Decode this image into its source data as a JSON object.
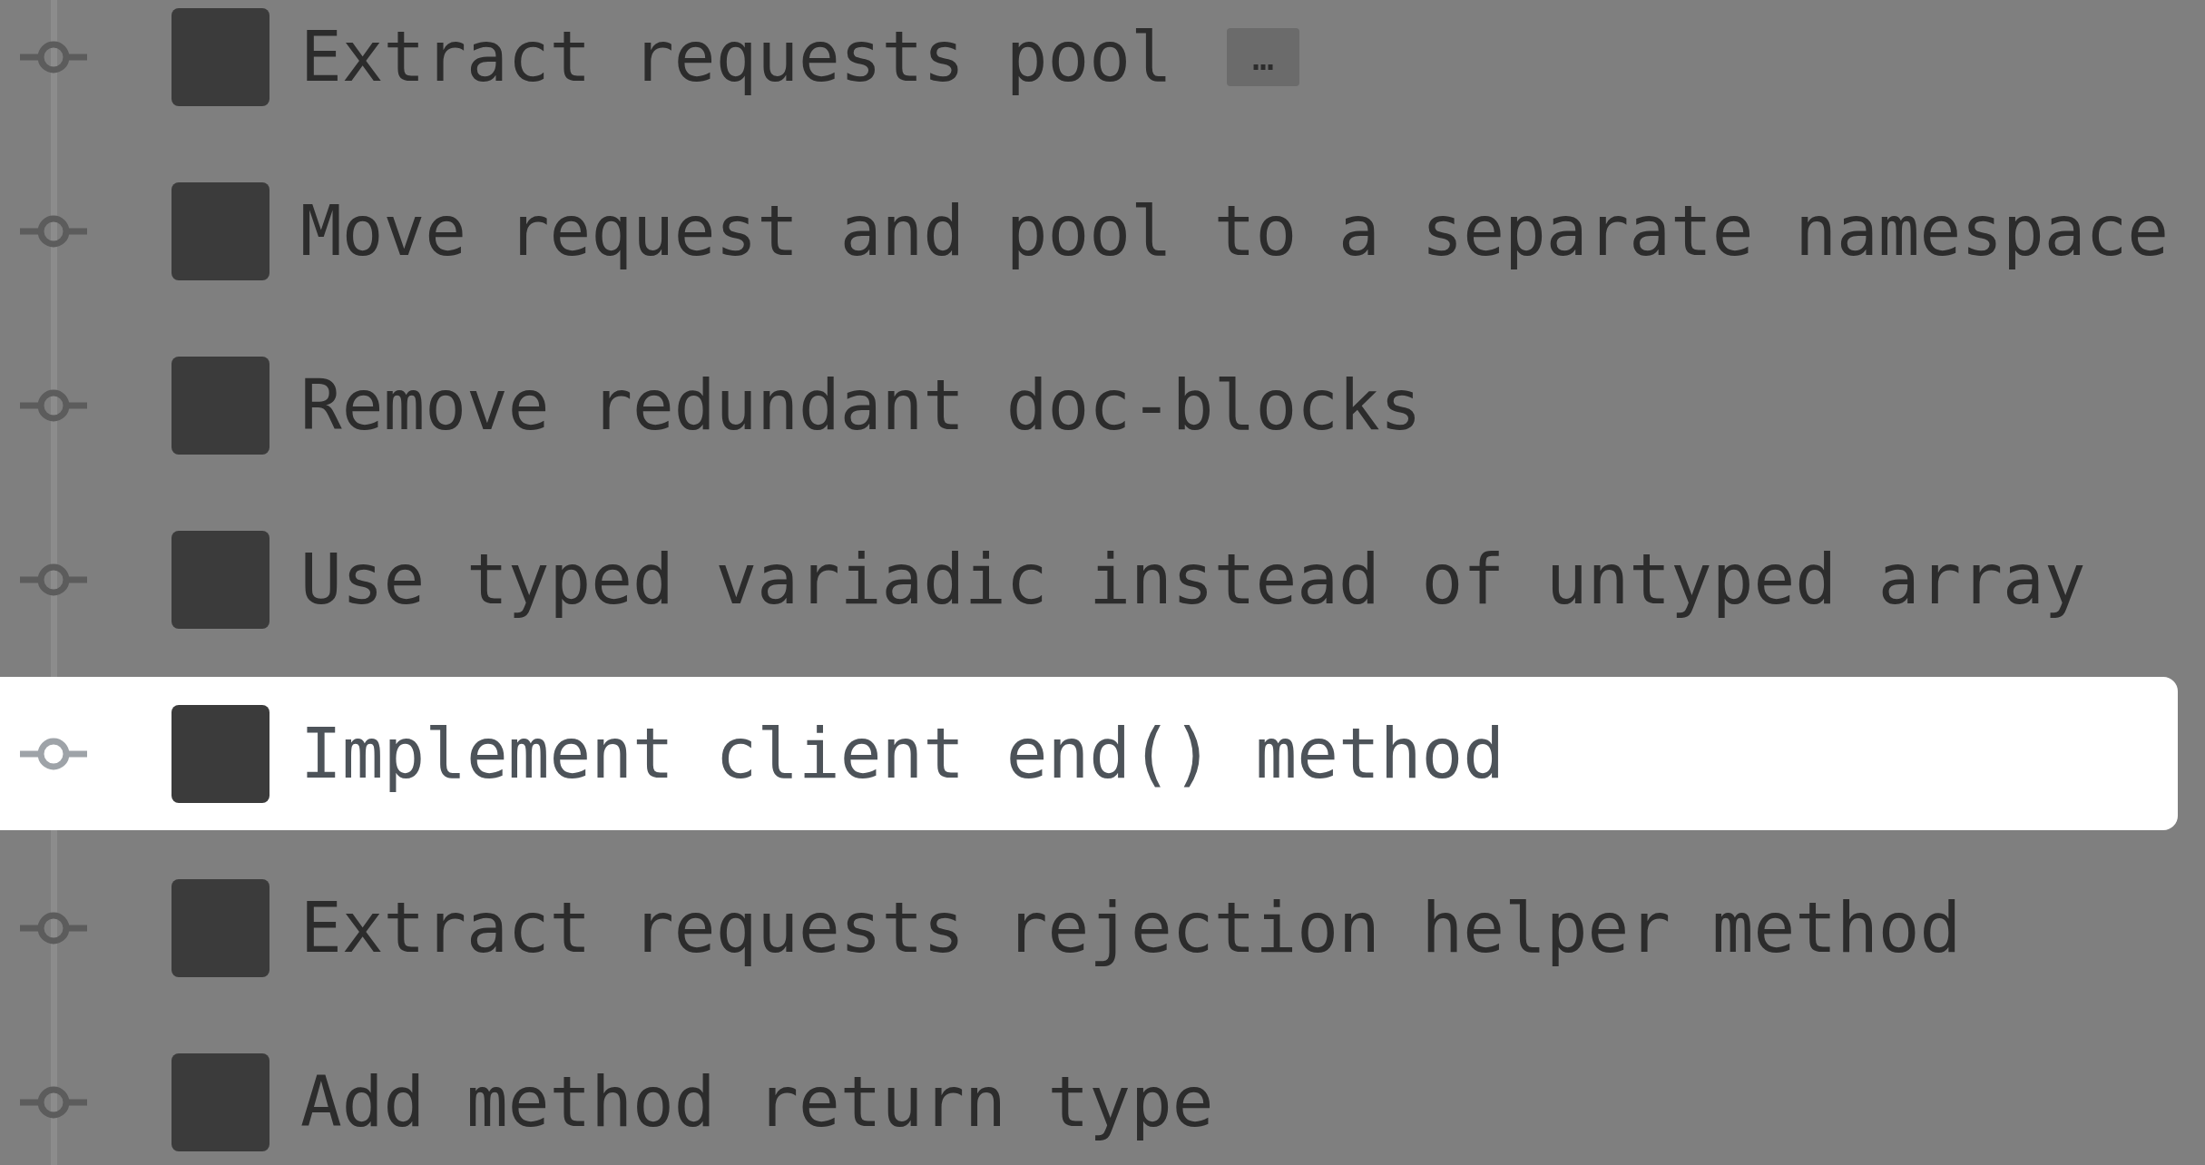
{
  "commits": [
    {
      "message": "Extract requests pool",
      "expander": "…",
      "selected": false
    },
    {
      "message": "Move request and pool to a separate namespace",
      "selected": false
    },
    {
      "message": "Remove redundant doc-blocks",
      "selected": false
    },
    {
      "message": "Use typed variadic instead of untyped array",
      "selected": false
    },
    {
      "message": "Implement client end() method",
      "selected": true
    },
    {
      "message": "Extract requests rejection helper method",
      "selected": false
    },
    {
      "message": "Add method return type",
      "selected": false
    }
  ]
}
